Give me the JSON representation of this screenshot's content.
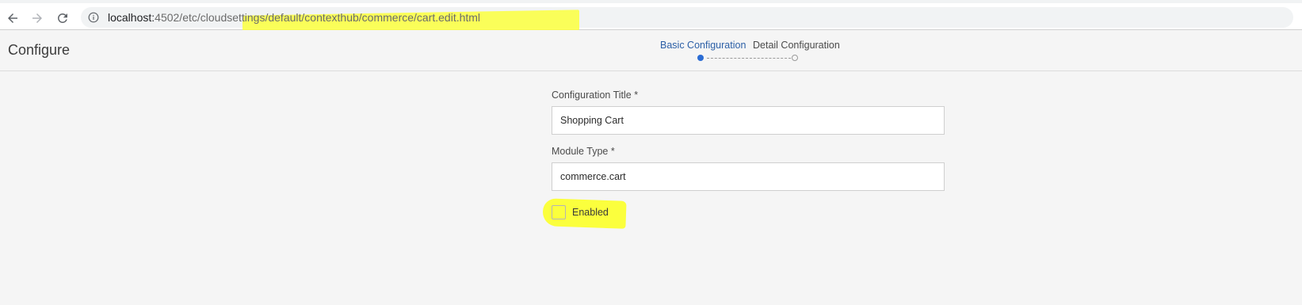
{
  "browser": {
    "url_host": "localhost:",
    "url_rest": "4502/etc/cloudsettings/default/contexthub/commerce/cart.edit.html",
    "icons": {
      "back": "arrow-left-icon",
      "forward": "arrow-right-icon",
      "reload": "reload-icon",
      "site_info": "info-icon"
    },
    "highlight_color": "#fbff3d"
  },
  "header": {
    "title": "Configure",
    "steps": [
      {
        "label": "Basic Configuration",
        "active": true
      },
      {
        "label": "Detail Configuration",
        "active": false
      }
    ],
    "active_color": "#2b5fa6"
  },
  "form": {
    "config_title_label": "Configuration Title *",
    "config_title_value": "Shopping Cart",
    "module_type_label": "Module Type *",
    "module_type_value": "commerce.cart",
    "enabled_label": "Enabled",
    "enabled_checked": false
  }
}
